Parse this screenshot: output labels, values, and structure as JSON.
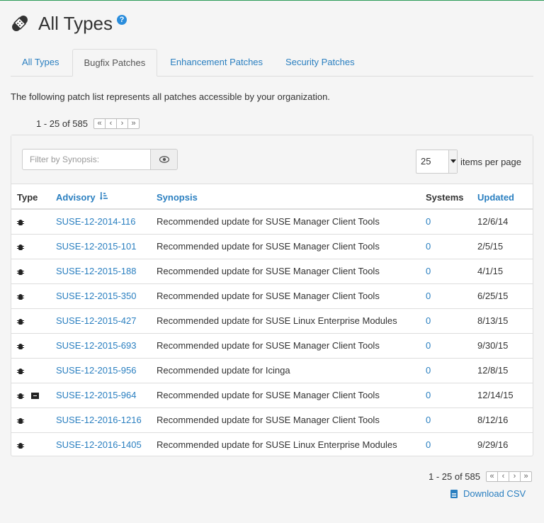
{
  "header": {
    "title": "All Types",
    "help": "?"
  },
  "tabs": [
    {
      "label": "All Types",
      "active": false
    },
    {
      "label": "Bugfix Patches",
      "active": true
    },
    {
      "label": "Enhancement Patches",
      "active": false
    },
    {
      "label": "Security Patches",
      "active": false
    }
  ],
  "intro_text": "The following patch list represents all patches accessible by your organization.",
  "pagination": {
    "range": "1 - 25 of 585",
    "first": "«",
    "prev": "‹",
    "next": "›",
    "last": "»"
  },
  "filter": {
    "placeholder": "Filter by Synopsis:",
    "button_icon": "eye-icon"
  },
  "per_page": {
    "value": "25",
    "label": "items per page"
  },
  "table": {
    "columns": {
      "type": "Type",
      "advisory": "Advisory",
      "synopsis": "Synopsis",
      "systems": "Systems",
      "updated": "Updated"
    },
    "rows": [
      {
        "advisory": "SUSE-12-2014-116",
        "synopsis": "Recommended update for SUSE Manager Client Tools",
        "systems": "0",
        "updated": "12/6/14"
      },
      {
        "advisory": "SUSE-12-2015-101",
        "synopsis": "Recommended update for SUSE Manager Client Tools",
        "systems": "0",
        "updated": "2/5/15"
      },
      {
        "advisory": "SUSE-12-2015-188",
        "synopsis": "Recommended update for SUSE Manager Client Tools",
        "systems": "0",
        "updated": "4/1/15"
      },
      {
        "advisory": "SUSE-12-2015-350",
        "synopsis": "Recommended update for SUSE Manager Client Tools",
        "systems": "0",
        "updated": "6/25/15"
      },
      {
        "advisory": "SUSE-12-2015-427",
        "synopsis": "Recommended update for SUSE Linux Enterprise Modules",
        "systems": "0",
        "updated": "8/13/15"
      },
      {
        "advisory": "SUSE-12-2015-693",
        "synopsis": "Recommended update for SUSE Manager Client Tools",
        "systems": "0",
        "updated": "9/30/15"
      },
      {
        "advisory": "SUSE-12-2015-956",
        "synopsis": "Recommended update for Icinga",
        "systems": "0",
        "updated": "12/8/15"
      },
      {
        "advisory": "SUSE-12-2015-964",
        "synopsis": "Recommended update for SUSE Manager Client Tools",
        "systems": "0",
        "updated": "12/14/15",
        "extra_icon": "archive-icon"
      },
      {
        "advisory": "SUSE-12-2016-1216",
        "synopsis": "Recommended update for SUSE Manager Client Tools",
        "systems": "0",
        "updated": "8/12/16"
      },
      {
        "advisory": "SUSE-12-2016-1405",
        "synopsis": "Recommended update for SUSE Linux Enterprise Modules",
        "systems": "0",
        "updated": "9/29/16"
      }
    ]
  },
  "download_label": "Download CSV",
  "colors": {
    "link": "#2a7fc0",
    "accent_border": "#2e9c5a"
  }
}
